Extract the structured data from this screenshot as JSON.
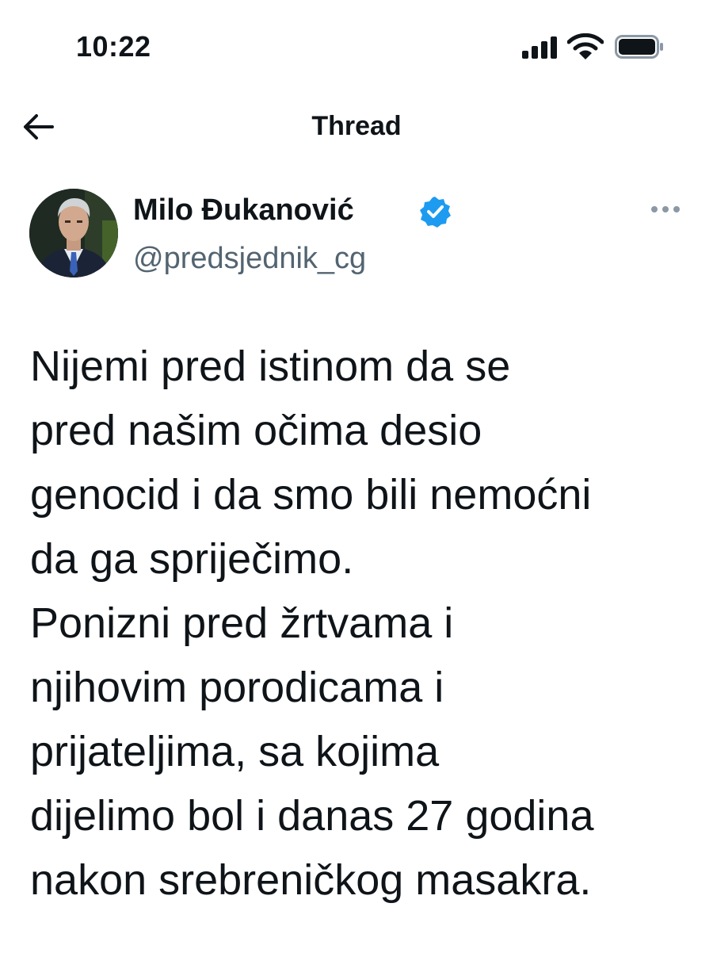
{
  "status_bar": {
    "time": "10:22"
  },
  "nav": {
    "title": "Thread"
  },
  "author": {
    "name": "Milo Đukanović",
    "handle": "@predsjednik_cg",
    "verified": true
  },
  "tweet": {
    "lines": [
      "Nijemi pred istinom da se",
      "pred našim očima desio",
      "genocid i da smo bili nemoćni",
      "da ga spriječimo.",
      "Ponizni pred žrtvama i",
      "njihovim porodicama i",
      "prijateljima, sa kojima",
      "dijelimo bol i danas 27 godina",
      "nakon srebreničkog masakra."
    ]
  },
  "colors": {
    "text": "#0f1419",
    "secondary": "#536471",
    "verified_badge": "#1d9bf0",
    "background": "#ffffff"
  },
  "icons": {
    "back": "back-arrow-icon",
    "verified": "verified-badge-icon",
    "more": "more-options-icon",
    "signal": "cellular-signal-icon",
    "wifi": "wifi-icon",
    "battery": "battery-icon"
  }
}
